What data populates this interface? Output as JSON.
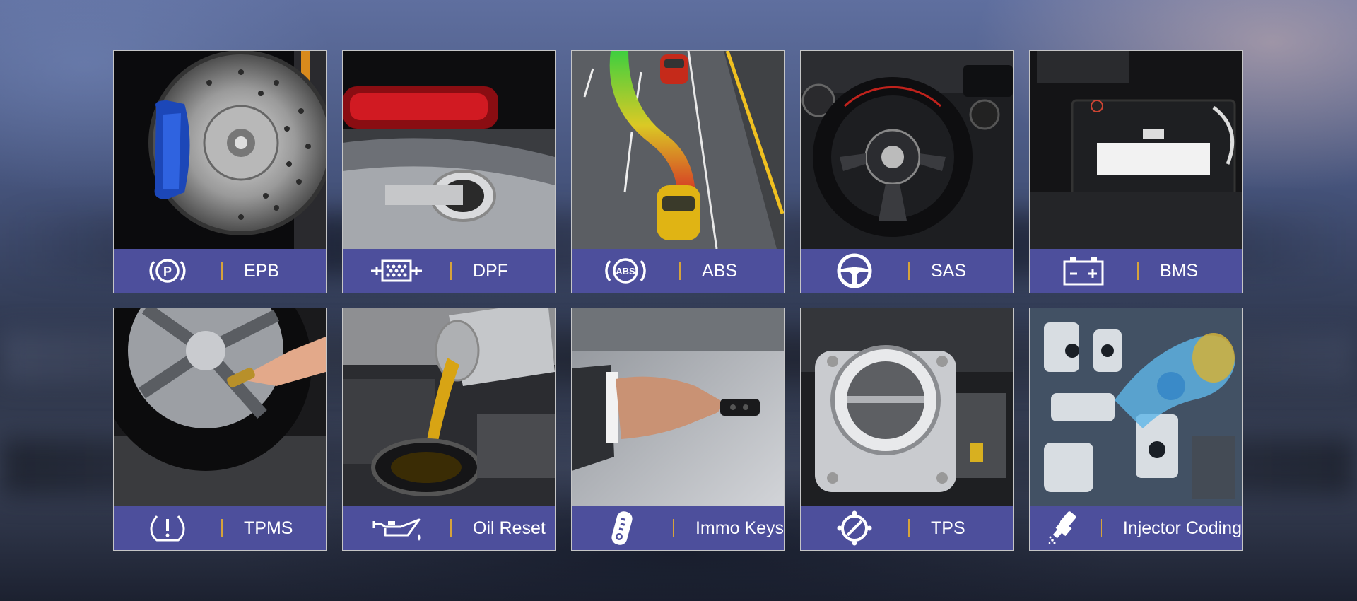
{
  "colors": {
    "band": "#4d4f9c",
    "separator": "#d6a33a",
    "label": "#ffffff"
  },
  "functions": [
    {
      "label": "EPB",
      "icon": "parking-brake-icon",
      "photo": "brake-disc-caliper"
    },
    {
      "label": "DPF",
      "icon": "particulate-filter-icon",
      "photo": "exhaust-tailpipe"
    },
    {
      "label": "ABS",
      "icon": "abs-icon",
      "photo": "car-braking-on-road"
    },
    {
      "label": "SAS",
      "icon": "steering-wheel-icon",
      "photo": "steering-wheel"
    },
    {
      "label": "BMS",
      "icon": "battery-icon",
      "photo": "car-battery"
    },
    {
      "label": "TPMS",
      "icon": "tire-pressure-icon",
      "photo": "tire-valve"
    },
    {
      "label": "Oil Reset",
      "icon": "oil-can-icon",
      "photo": "oil-pouring"
    },
    {
      "label": "Immo Keys",
      "icon": "key-fob-icon",
      "photo": "hand-with-key"
    },
    {
      "label": "TPS",
      "icon": "throttle-icon",
      "photo": "throttle-body"
    },
    {
      "label": "Injector Coding",
      "icon": "injector-icon",
      "photo": "engine-cutaway"
    }
  ]
}
